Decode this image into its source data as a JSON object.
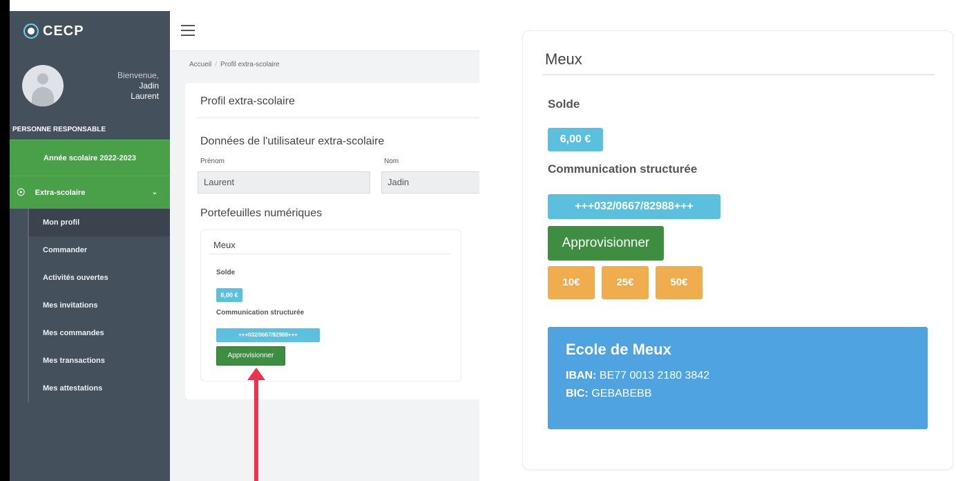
{
  "sidebar": {
    "logo": "CECP",
    "welcome": "Bienvenue,",
    "user_first": "Jadin",
    "user_last": "Laurent",
    "role": "PERSONNE RESPONSABLE",
    "year": "Année scolaire 2022-2023",
    "section": "Extra-scolaire",
    "menu": [
      "Mon profil",
      "Commander",
      "Activités ouvertes",
      "Mes invitations",
      "Mes commandes",
      "Mes transactions",
      "Mes attestations"
    ]
  },
  "breadcrumb": {
    "home": "Accueil",
    "current": "Profil extra-scolaire"
  },
  "profile": {
    "title": "Profil extra-scolaire",
    "user_section": "Données de l'utilisateur extra-scolaire",
    "first_label": "Prénom",
    "first_value": "Laurent",
    "last_label": "Nom",
    "last_value": "Jadin",
    "wallets_title": "Portefeuilles numériques"
  },
  "wallet": {
    "name": "Meux",
    "balance_label": "Solde",
    "balance": "6,00 €",
    "comm_label": "Communication structurée",
    "comm": "+++032/0667/82988+++",
    "topup_label": "Approvisionner",
    "amounts": [
      "10€",
      "25€",
      "50€"
    ]
  },
  "bank": {
    "name": "Ecole de Meux",
    "iban_label": "IBAN:",
    "iban": "BE77 0013 2180 3842",
    "bic_label": "BIC:",
    "bic": "GEBABEBB"
  },
  "colors": {
    "green": "#3e8e41",
    "info": "#5bc0de",
    "warning": "#f0ad4e",
    "bank": "#4fa3e0",
    "sidebar": "#45505d",
    "arrow": "#ee3350"
  }
}
